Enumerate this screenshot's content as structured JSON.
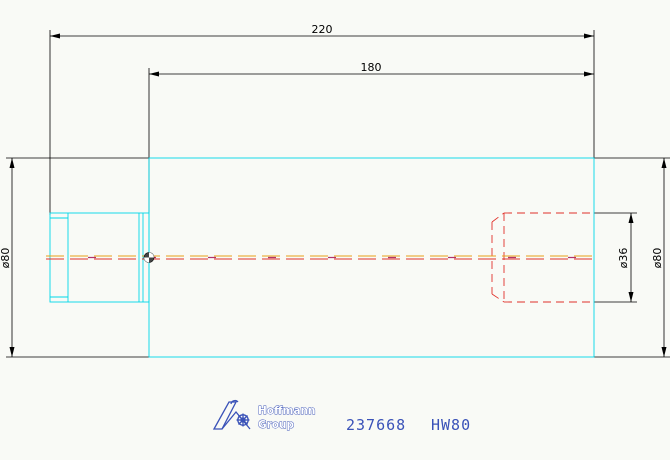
{
  "drawing": {
    "dimensions": {
      "overall_length": "220",
      "inner_length": "180",
      "outer_diameter_left": "ø80",
      "outer_diameter_right": "ø80",
      "bore_diameter": "ø36"
    },
    "title_block": {
      "brand_line1": "Hoffmann",
      "brand_line2": "Group",
      "part_number": "237668",
      "part_code": "HW80"
    },
    "colors": {
      "body_outline": "#00d8e8",
      "dimension_lines": "#000000",
      "hidden_lines": "#e0302a",
      "center_line": "#e8a018",
      "brand": "#3a52b8"
    },
    "icons": [
      "hoffmann-logo-icon",
      "center-mark-icon"
    ]
  }
}
